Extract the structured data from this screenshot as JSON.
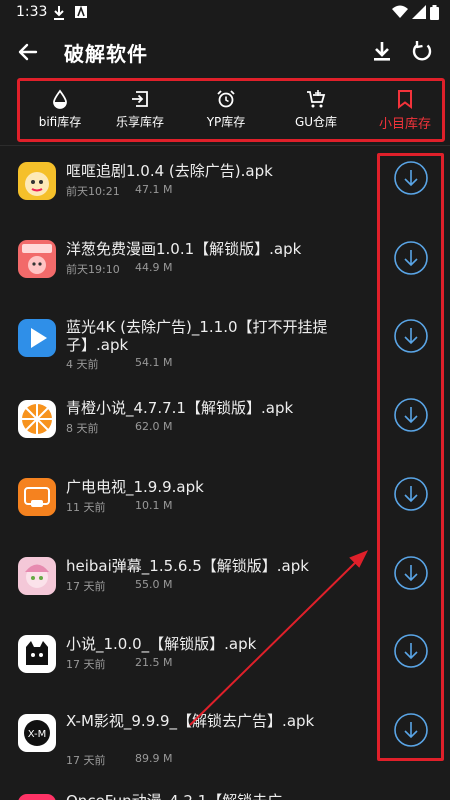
{
  "status_bar": {
    "time": "1:33"
  },
  "header": {
    "title": "破解软件"
  },
  "tabs": [
    {
      "label": "bifi库存",
      "icon": "water-drop-icon"
    },
    {
      "label": "乐享库存",
      "icon": "login-box-icon"
    },
    {
      "label": "YP库存",
      "icon": "alarm-clock-icon"
    },
    {
      "label": "GU仓库",
      "icon": "cart-plus-icon"
    },
    {
      "label": "小目库存",
      "icon": "bookmark-icon",
      "active": true
    }
  ],
  "colors": {
    "accent_red": "#f2333b",
    "download_blue": "#5aa5e6",
    "background": "#1b1b1b"
  },
  "apps": [
    {
      "name": "哐哐追剧1.0.4 (去除广告).apk",
      "date": "前天10:21",
      "size": "47.1 M"
    },
    {
      "name": "洋葱免费漫画1.0.1【解锁版】.apk",
      "date": "前天19:10",
      "size": "44.9 M"
    },
    {
      "name": "蓝光4K (去除广告)_1.1.0【打不开挂提子】.apk",
      "date": "4 天前",
      "size": "54.1 M"
    },
    {
      "name": "青橙小说_4.7.7.1【解锁版】.apk",
      "date": "8 天前",
      "size": "62.0 M"
    },
    {
      "name": "广电电视_1.9.9.apk",
      "date": "11 天前",
      "size": "10.1 M"
    },
    {
      "name": "heibai弹幕_1.5.6.5【解锁版】.apk",
      "date": "17 天前",
      "size": "55.0 M"
    },
    {
      "name": "小说_1.0.0_【解锁版】.apk",
      "date": "17 天前",
      "size": "21.5 M"
    },
    {
      "name": "X-M影视_9.9.9_【解锁去广告】.apk",
      "date": "17 天前",
      "size": "89.9 M"
    },
    {
      "name": "OnceFun动漫_4.2.1【解锁去广",
      "date": "",
      "size": ""
    }
  ]
}
